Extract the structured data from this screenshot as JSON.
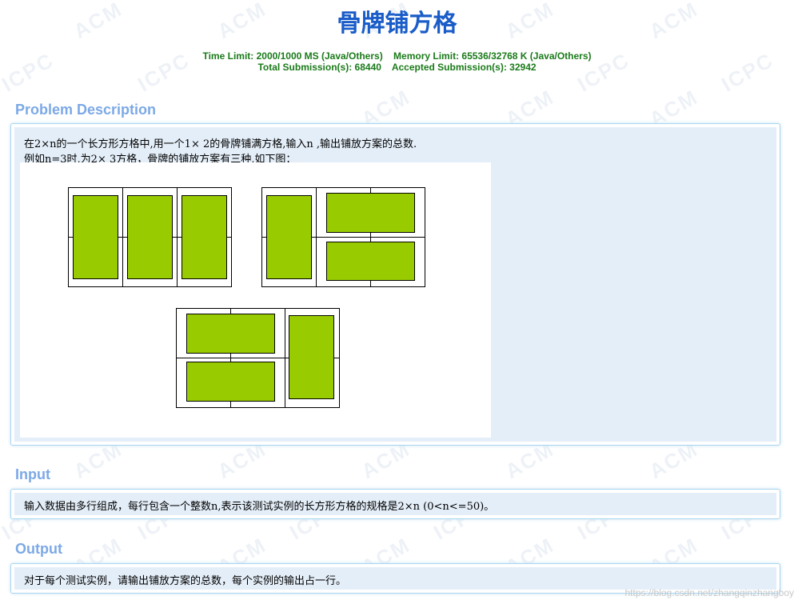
{
  "page": {
    "title": "骨牌铺方格",
    "limits_line1_time": "Time Limit: 2000/1000 MS (Java/Others)",
    "limits_line1_memory": "Memory Limit: 65536/32768 K (Java/Others)",
    "limits_line2_total": "Total Submission(s): 68440",
    "limits_line2_accepted": "Accepted Submission(s): 32942"
  },
  "watermark": {
    "words": [
      "ACM",
      "ICPC"
    ]
  },
  "sections": {
    "description": {
      "heading": "Problem Description",
      "line1": "在2×n的一个长方形方格中,用一个1× 2的骨牌铺满方格,输入n ,输出铺放方案的总数.",
      "line2": "例如n=3时,为2× 3方格，骨牌的铺放方案有三种,如下图："
    },
    "input": {
      "heading": "Input",
      "text": "输入数据由多行组成，每行包含一个整数n,表示该测试实例的长方形方格的规格是2×n (0<n<=50)。"
    },
    "output": {
      "heading": "Output",
      "text": "对于每个测试实例，请输出铺放方案的总数，每个实例的输出占一行。"
    }
  },
  "figure": {
    "tile_color": "#99cc00",
    "grid_color": "#000000",
    "board_size": "2x3",
    "tilings": [
      [
        "vertical",
        "vertical",
        "vertical"
      ],
      [
        "vertical",
        "horizontal-pair"
      ],
      [
        "horizontal-pair",
        "vertical"
      ]
    ]
  },
  "footer": {
    "credit": "https://blog.csdn.net/zhangqinzhangboy"
  }
}
